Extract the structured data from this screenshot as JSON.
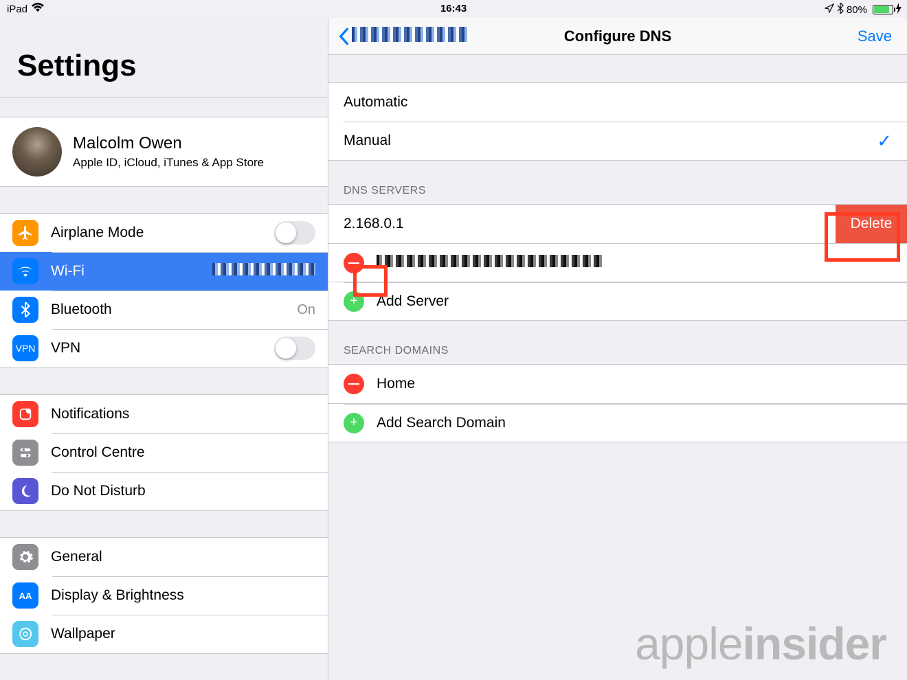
{
  "status": {
    "device": "iPad",
    "time": "16:43",
    "battery_pct": "80%"
  },
  "sidebar": {
    "title": "Settings",
    "profile": {
      "name": "Malcolm Owen",
      "sub": "Apple ID, iCloud, iTunes & App Store"
    },
    "rows": {
      "airplane": "Airplane Mode",
      "wifi": "Wi-Fi",
      "wifi_value": "████████",
      "bluetooth": "Bluetooth",
      "bluetooth_value": "On",
      "vpn": "VPN",
      "notifications": "Notifications",
      "control_centre": "Control Centre",
      "dnd": "Do Not Disturb",
      "general": "General",
      "display": "Display & Brightness",
      "wallpaper": "Wallpaper"
    }
  },
  "detail": {
    "back_label": "████████",
    "title": "Configure DNS",
    "save": "Save",
    "mode": {
      "automatic": "Automatic",
      "manual": "Manual"
    },
    "dns_header": "DNS SERVERS",
    "dns_row_swiped": "2.168.0.1",
    "delete": "Delete",
    "dns_row_2": "████████████████",
    "add_server": "Add Server",
    "search_header": "SEARCH DOMAINS",
    "search_domain": "Home",
    "add_search": "Add Search Domain"
  },
  "watermark": {
    "a": "apple",
    "b": "insider"
  }
}
